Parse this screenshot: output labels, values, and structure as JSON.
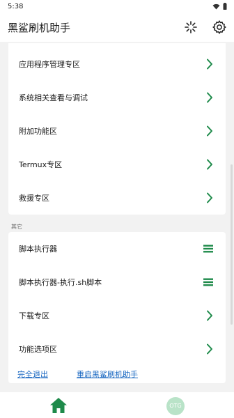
{
  "status_bar": {
    "time": "5:38"
  },
  "app_bar": {
    "title": "黑鲨刷机助手",
    "icons": [
      "loading-spinner-icon",
      "gear-icon"
    ]
  },
  "main_section": {
    "items": [
      {
        "label": "应用程序管理专区",
        "icon": "chevron-right-icon"
      },
      {
        "label": "系统相关查看与调试",
        "icon": "chevron-right-icon"
      },
      {
        "label": "附加功能区",
        "icon": "chevron-right-icon"
      },
      {
        "label": "Termux专区",
        "icon": "chevron-right-icon"
      },
      {
        "label": "救援专区",
        "icon": "chevron-right-icon"
      }
    ]
  },
  "other_section": {
    "label": "其它",
    "items": [
      {
        "label": "脚本执行器",
        "icon": "menu-icon"
      },
      {
        "label": "脚本执行器-执行.sh脚本",
        "icon": "menu-icon"
      },
      {
        "label": "下载专区",
        "icon": "chevron-right-icon"
      },
      {
        "label": "功能选项区",
        "icon": "chevron-right-icon"
      }
    ],
    "links": {
      "exit": "完全退出",
      "restart": "重启黑鲨刷机助手"
    }
  },
  "bottom_nav": {
    "home_icon": "home-icon",
    "otg_label": "OTG"
  },
  "colors": {
    "accent": "#1e8a4a",
    "link": "#1565c0",
    "background": "#f2f2f2"
  }
}
